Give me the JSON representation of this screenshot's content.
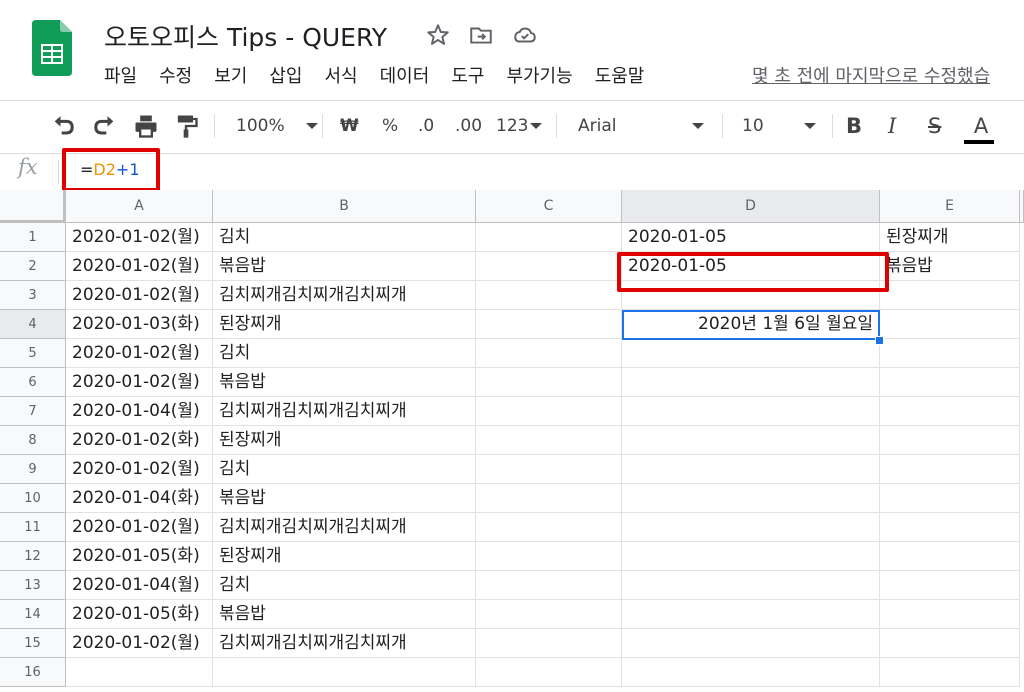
{
  "title": "오토오피스 Tips - QUERY",
  "menu": [
    "파일",
    "수정",
    "보기",
    "삽입",
    "서식",
    "데이터",
    "도구",
    "부가기능",
    "도움말"
  ],
  "last_edit": "몇 초 전에 마지막으로 수정했습",
  "toolbar": {
    "zoom": "100%",
    "currency": "₩",
    "percent": "%",
    "decrease_decimal": ".0",
    "increase_decimal": ".00",
    "more_formats": "123",
    "font": "Arial",
    "font_size": "10",
    "bold": "B",
    "italic": "I",
    "strike": "S",
    "text_color": "A"
  },
  "formula_bar": {
    "fx": "fx",
    "eq": "=",
    "ref": "D2",
    "rest": "+1"
  },
  "columns": [
    "A",
    "B",
    "C",
    "D",
    "E"
  ],
  "rows": [
    "1",
    "2",
    "3",
    "4",
    "5",
    "6",
    "7",
    "8",
    "9",
    "10",
    "11",
    "12",
    "13",
    "14",
    "15",
    "16"
  ],
  "cells": {
    "A": [
      "2020-01-02(월)",
      "2020-01-02(월)",
      "2020-01-02(월)",
      "2020-01-03(화)",
      "2020-01-02(월)",
      "2020-01-02(월)",
      "2020-01-04(월)",
      "2020-01-02(화)",
      "2020-01-02(월)",
      "2020-01-04(화)",
      "2020-01-02(월)",
      "2020-01-05(화)",
      "2020-01-04(월)",
      "2020-01-05(화)",
      "2020-01-02(월)",
      ""
    ],
    "B": [
      "김치",
      "볶음밥",
      "김치찌개김치찌개김치찌개",
      "된장찌개",
      "김치",
      "볶음밥",
      "김치찌개김치찌개김치찌개",
      "된장찌개",
      "김치",
      "볶음밥",
      "김치찌개김치찌개김치찌개",
      "된장찌개",
      "김치",
      "볶음밥",
      "김치찌개김치찌개김치찌개",
      ""
    ],
    "D1": "2020-01-05",
    "D2": "2020-01-05",
    "D4": "2020년 1월 6일 월요일",
    "E1": "된장찌개",
    "E2": "볶음밥"
  },
  "colors": {
    "highlight": "#e00000",
    "selection": "#1a73e8",
    "formula_ref": "#f09300",
    "formula_op": "#1155cc"
  }
}
